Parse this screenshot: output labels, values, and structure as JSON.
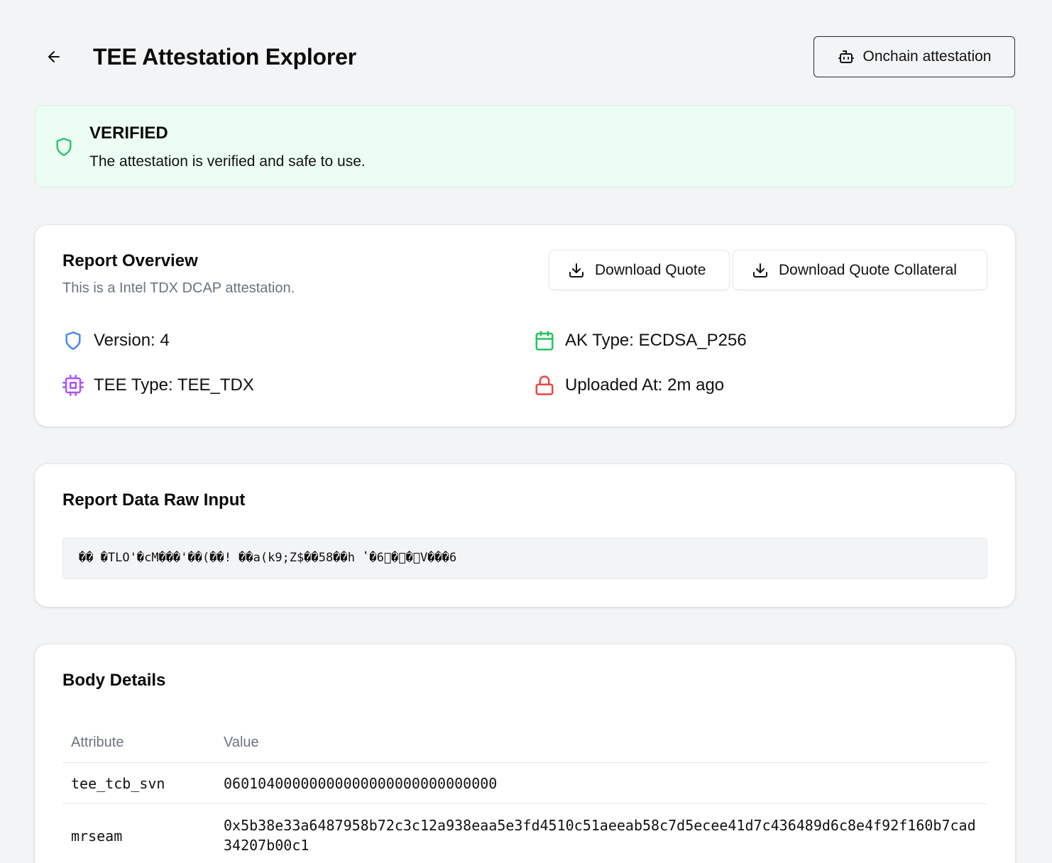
{
  "header": {
    "title": "TEE Attestation Explorer",
    "onchain_label": "Onchain attestation"
  },
  "status": {
    "title": "VERIFIED",
    "message": "The attestation is verified and safe to use.",
    "color": "#22c55e"
  },
  "overview": {
    "title": "Report Overview",
    "subtitle": "This is a Intel TDX DCAP attestation.",
    "download_quote_label": "Download Quote",
    "download_collateral_label": "Download Quote Collateral",
    "version": "Version: 4",
    "tee_type": "TEE Type: TEE_TDX",
    "ak_type": "AK Type: ECDSA_P256",
    "uploaded_at": "Uploaded At: 2m ago",
    "icon_colors": {
      "version": "#3b82f6",
      "tee_type": "#a855f7",
      "ak_type": "#22c55e",
      "uploaded_at": "#ef4444"
    }
  },
  "raw_input": {
    "title": "Report Data Raw Input",
    "value": "�� �TLO'�cM���'��(��! ��a(k9;Z$��58��h ʽ�6⃞�⃞�⃞V���6"
  },
  "body_details": {
    "title": "Body Details",
    "col_attribute": "Attribute",
    "col_value": "Value",
    "rows": [
      {
        "attribute": "tee_tcb_svn",
        "value": "06010400000000000000000000000000"
      },
      {
        "attribute": "mrseam",
        "value": "0x5b38e33a6487958b72c3c12a938eaa5e3fd4510c51aeeab58c7d5ecee41d7c436489d6c8e4f92f160b7cad34207b00c1"
      }
    ]
  }
}
